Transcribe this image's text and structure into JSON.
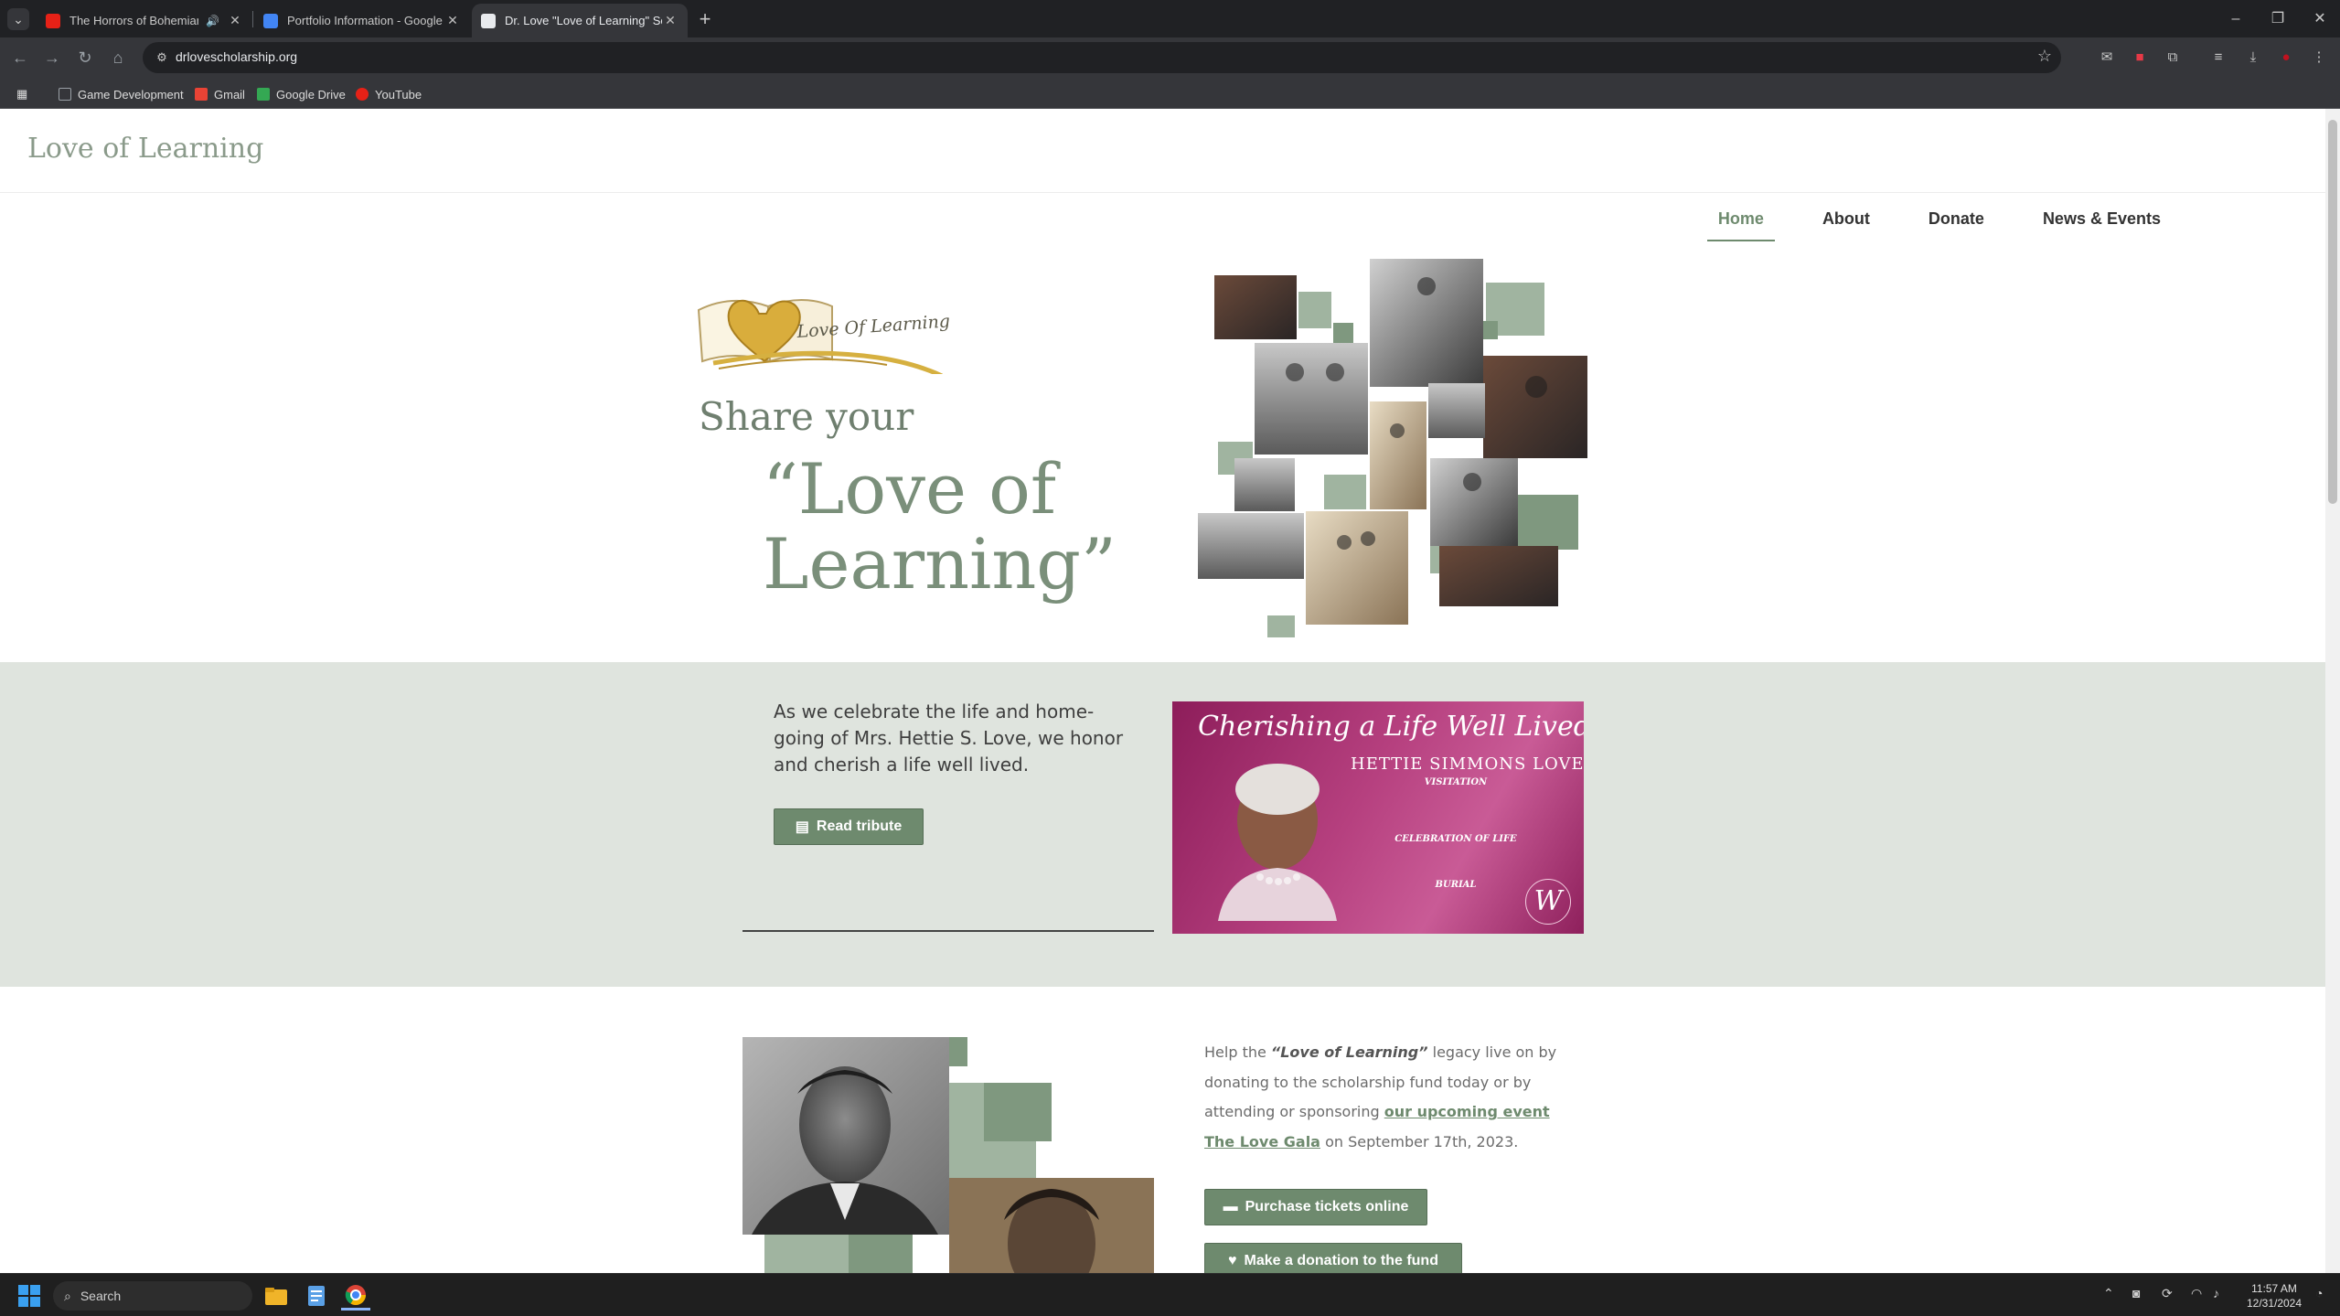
{
  "browser": {
    "tabs": [
      {
        "title": "The Horrors of Bohemian G",
        "favicon_color": "#e62117",
        "speaker": "🔊",
        "active": false
      },
      {
        "title": "Portfolio Information - Google",
        "favicon_color": "#4285f4",
        "speaker": "",
        "active": false
      },
      {
        "title": "Dr. Love \"Love of Learning\" Sc",
        "favicon_color": "#e8eaed",
        "speaker": "",
        "active": true
      }
    ],
    "url": "drlovescholarship.org",
    "bookmarks": [
      {
        "label": "Game Development",
        "icon": "folder-icon",
        "color": "#9aa0a6"
      },
      {
        "label": "Gmail",
        "icon": "gmail-icon",
        "color": "#ea4335"
      },
      {
        "label": "Google Drive",
        "icon": "drive-icon",
        "color": "#34a853"
      },
      {
        "label": "YouTube",
        "icon": "youtube-icon",
        "color": "#e62117"
      }
    ]
  },
  "site": {
    "title": "Love of Learning",
    "nav": [
      {
        "label": "Home",
        "active": true
      },
      {
        "label": "About",
        "active": false
      },
      {
        "label": "Donate",
        "active": false
      },
      {
        "label": "News & Events",
        "active": false
      }
    ],
    "logo_text": "Love Of Learning",
    "hero": {
      "share": "Share your",
      "quote": "“Love of Learning”"
    },
    "tribute": {
      "text": "As we celebrate the life and home-going of Mrs. Hettie S. Love, we honor and cherish a life well lived.",
      "button": "Read tribute"
    },
    "flyer": {
      "headline": "Cherishing a Life Well Lived",
      "name": "HETTIE SIMMONS LOVE",
      "visitation": "VISITATION",
      "celebration": "CELEBRATION OF LIFE",
      "burial": "BURIAL",
      "seal": "W"
    },
    "help": {
      "p1": "Help the ",
      "em": "“Love of Learning”",
      "p2": " legacy live on by donating to the scholarship fund today or by attending or sponsoring ",
      "link": "our upcoming event The Love Gala",
      "p3": " on September 17th, 2023."
    },
    "buttons": {
      "tickets": "Purchase tickets online",
      "donate": "Make a donation to the fund"
    }
  },
  "colors": {
    "accent": "#6e8a6e",
    "band": "#dfe4de",
    "flyer": "#b6407f"
  },
  "taskbar": {
    "search": "Search",
    "time": "11:57 AM",
    "date": "12/31/2024"
  }
}
